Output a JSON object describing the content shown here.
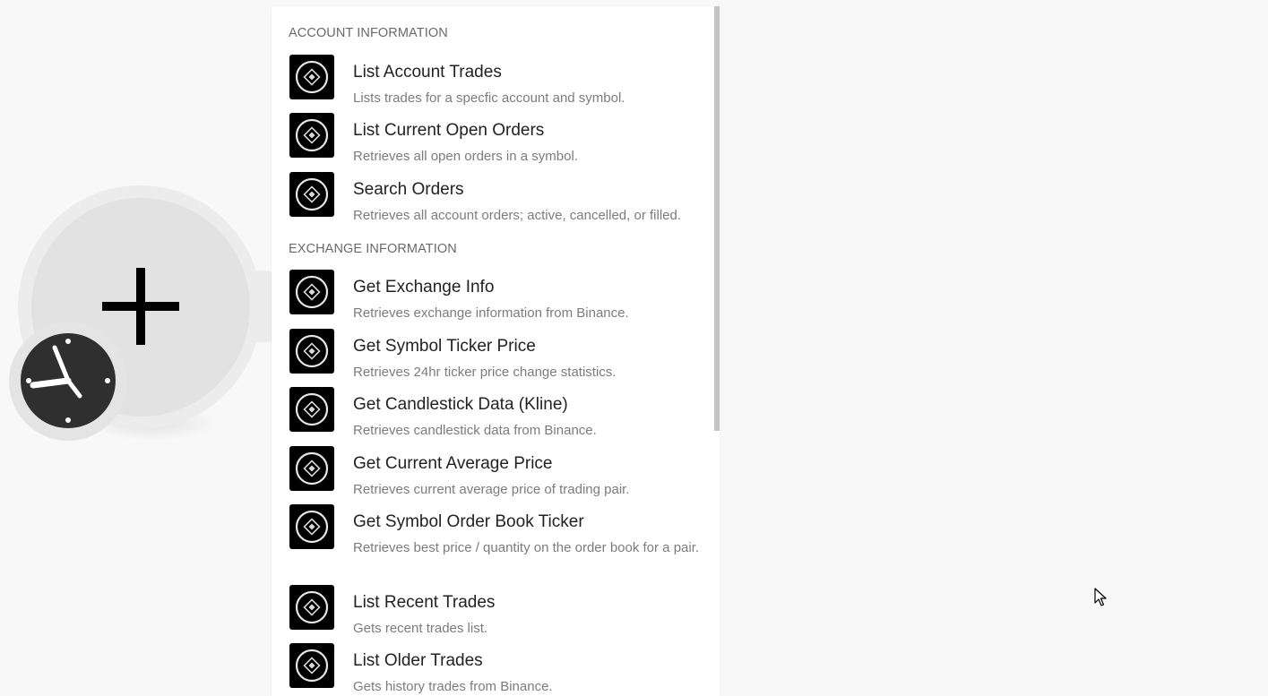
{
  "module": {
    "add_icon": "plus-icon",
    "trigger_icon": "clock-icon"
  },
  "menu": {
    "sections": [
      {
        "header": "ACCOUNT INFORMATION",
        "items": [
          {
            "title": "List Account Trades",
            "desc": "Lists trades for a specfic account and symbol.",
            "icon": "binance-icon"
          },
          {
            "title": "List Current Open Orders",
            "desc": "Retrieves all open orders in a symbol.",
            "icon": "binance-icon"
          },
          {
            "title": "Search Orders",
            "desc": "Retrieves all account orders; active, cancelled, or filled.",
            "icon": "binance-icon"
          }
        ]
      },
      {
        "header": "EXCHANGE INFORMATION",
        "items": [
          {
            "title": "Get Exchange Info",
            "desc": "Retrieves exchange information from Binance.",
            "icon": "binance-icon"
          },
          {
            "title": "Get Symbol Ticker Price",
            "desc": "Retrieves 24hr ticker price change statistics.",
            "icon": "binance-icon"
          },
          {
            "title": "Get Candlestick Data (Kline)",
            "desc": "Retrieves candlestick data from Binance.",
            "icon": "binance-icon"
          },
          {
            "title": "Get Current Average Price",
            "desc": "Retrieves current average price of trading pair.",
            "icon": "binance-icon"
          },
          {
            "title": "Get Symbol Order Book Ticker",
            "desc": "Retrieves best price / quantity on the order book for a pair.",
            "icon": "binance-icon"
          },
          {
            "title": "List Recent Trades",
            "desc": "Gets recent trades list.",
            "icon": "binance-icon"
          },
          {
            "title": "List Older Trades",
            "desc": "Gets history trades from Binance.",
            "icon": "binance-icon"
          }
        ]
      }
    ]
  },
  "colors": {
    "background": "#f8f8f8",
    "icon_bg": "#000000",
    "title": "#222222",
    "desc": "#7c7c7c",
    "header": "#6a6a6a"
  }
}
